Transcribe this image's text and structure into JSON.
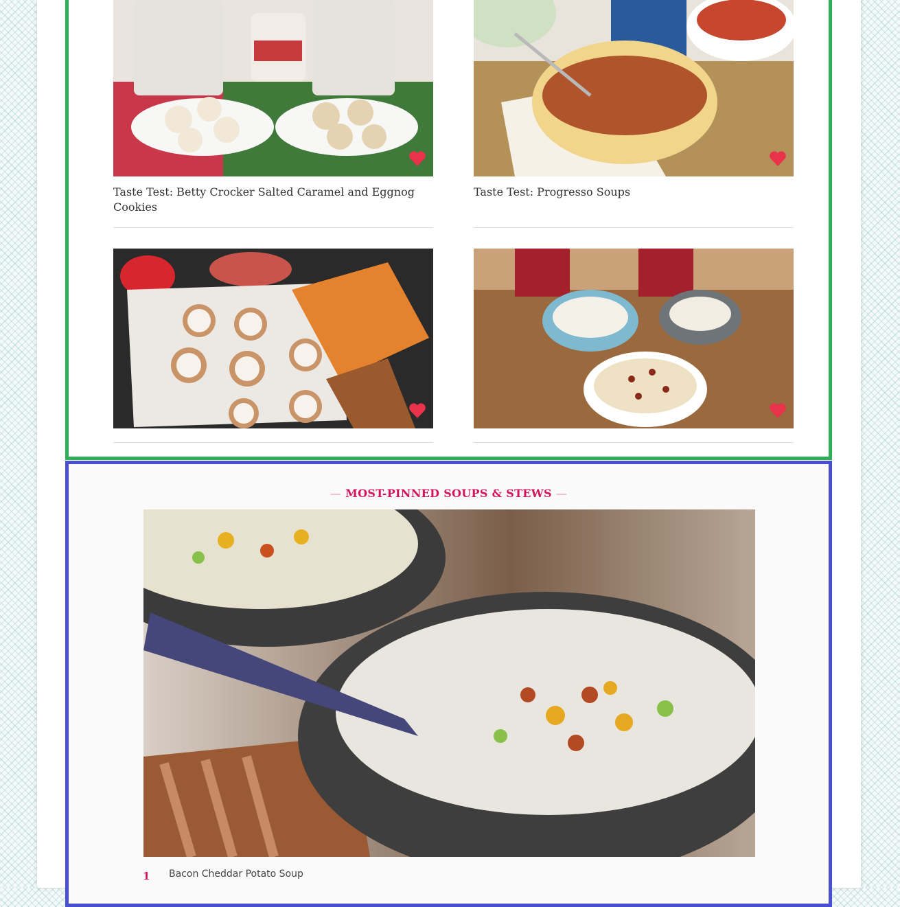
{
  "cards": [
    {
      "title": "Taste Test: Betty Crocker Salted Caramel and Eggnog Cookies",
      "image_alt": "cookies",
      "favorite_icon": "heart-icon"
    },
    {
      "title": "Taste Test: Progresso Soups",
      "image_alt": "soup",
      "favorite_icon": "heart-icon"
    },
    {
      "title": "",
      "image_alt": "pumpkin cookies",
      "favorite_icon": "heart-icon"
    },
    {
      "title": "",
      "image_alt": "mashed potatoes",
      "favorite_icon": "heart-icon"
    }
  ],
  "most_pinned": {
    "heading": "MOST-PINNED SOUPS & STEWS",
    "dash": "—",
    "items": [
      {
        "rank": "1",
        "title": "Bacon Cheddar Potato Soup"
      }
    ]
  },
  "colors": {
    "accent": "#d4145a",
    "heart": "#e8334a",
    "green_border": "#2fae57",
    "blue_border": "#4a4fd1"
  }
}
